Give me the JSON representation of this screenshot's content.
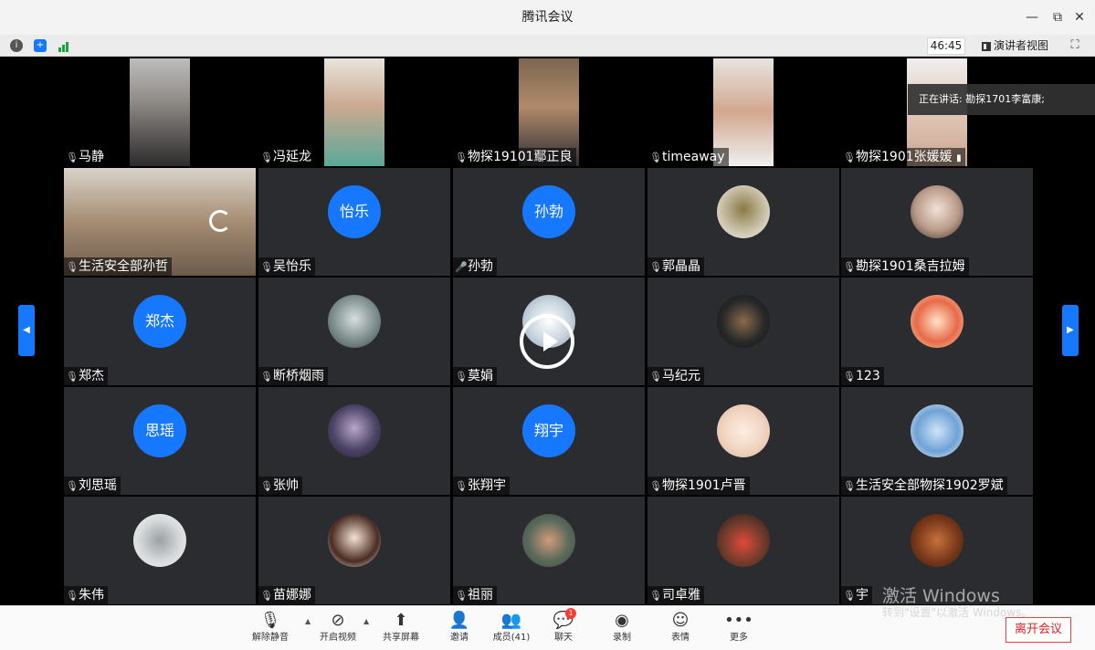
{
  "window": {
    "title": "腾讯会议",
    "minimize": "—",
    "restore": "⧉",
    "close": "✕"
  },
  "statusbar": {
    "timer": "46:45",
    "presenter_view": "演讲者视图"
  },
  "speaker": "正在讲话: 勘探1701李富康;",
  "tiles": [
    "马静",
    "冯延龙",
    "物探19101鄢正良",
    "timeaway",
    "物探1901张媛媛",
    "生活安全部孙哲",
    "吴怡乐",
    "孙勃",
    "郭晶晶",
    "勘探1901桑吉拉姆",
    "郑杰",
    "断桥烟雨",
    "莫娟",
    "马纪元",
    "123",
    "刘思瑶",
    "张帅",
    "张翔宇",
    "物探1901卢晋",
    "生活安全部物探1902罗斌",
    "朱伟",
    "苗娜娜",
    "祖丽",
    "司卓雅",
    "宇"
  ],
  "avatar_text": {
    "wu": "怡乐",
    "sun": "孙勃",
    "zheng": "郑杰",
    "liu": "思瑶",
    "zhang": "翔宇"
  },
  "toolbar": {
    "unmute": "解除静音",
    "video": "开启视频",
    "share": "共享屏幕",
    "invite": "邀请",
    "members": "成员(41)",
    "chat": "聊天",
    "chat_badge": "1",
    "record": "录制",
    "emoji": "表情",
    "more": "更多",
    "leave": "离开会议"
  },
  "watermark": {
    "line1": "激活 Windows",
    "line2": "转到\"设置\"以激活 Windows。"
  },
  "colors": {
    "accent": "#1677ff",
    "tile_bg": "#2b2c30",
    "leave": "#e02020"
  }
}
